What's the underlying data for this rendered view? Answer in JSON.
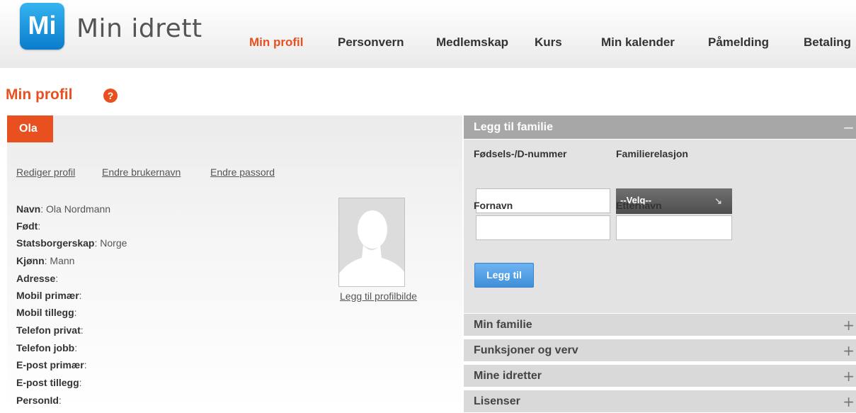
{
  "header": {
    "logo_mark": "Mi",
    "app_title": "Min idrett",
    "nav": [
      {
        "label": "Min profil",
        "active": true
      },
      {
        "label": "Personvern",
        "active": false
      },
      {
        "label": "Medlemskap",
        "active": false
      },
      {
        "label": "Kurs",
        "active": false
      },
      {
        "label": "Min kalender",
        "active": false
      },
      {
        "label": "Påmelding",
        "active": false
      },
      {
        "label": "Betaling",
        "active": false
      }
    ]
  },
  "page": {
    "title": "Min profil",
    "help_icon": "?"
  },
  "profile": {
    "name_tab": "Ola",
    "links": [
      "Rediger profil",
      "Endre brukernavn",
      "Endre passord"
    ],
    "fields": [
      {
        "label": "Navn",
        "value": ": Ola Nordmann"
      },
      {
        "label": "Født",
        "value": ":"
      },
      {
        "label": "Statsborgerskap",
        "value": ": Norge"
      },
      {
        "label": "Kjønn",
        "value": ": Mann"
      },
      {
        "label": "Adresse",
        "value": ":"
      },
      {
        "label": "Mobil primær",
        "value": ":"
      },
      {
        "label": "Mobil tillegg",
        "value": ":"
      },
      {
        "label": "Telefon privat",
        "value": ":"
      },
      {
        "label": "Telefon jobb",
        "value": ":"
      },
      {
        "label": "E-post primær",
        "value": ":"
      },
      {
        "label": "E-post tillegg",
        "value": ":"
      },
      {
        "label": "PersonId",
        "value": ":"
      }
    ],
    "add_photo_link": "Legg til profilbilde"
  },
  "family": {
    "add_section": {
      "title": "Legg til familie",
      "toggle_icon": "−",
      "birth_number_label": "Fødsels-/D-nummer",
      "birth_number_value": "",
      "relation_label": "Familierelasjon",
      "relation_selected": "--Velg--",
      "first_name_label": "Fornavn",
      "first_name_value": "",
      "last_name_label": "Etternavn",
      "last_name_value": "",
      "add_button": "Legg til"
    },
    "sections": [
      {
        "title": "Min familie",
        "toggle_icon": "+"
      },
      {
        "title": "Funksjoner og verv",
        "toggle_icon": "+"
      },
      {
        "title": "Mine idretter",
        "toggle_icon": "+"
      },
      {
        "title": "Lisenser",
        "toggle_icon": "+"
      }
    ]
  },
  "colors": {
    "accent": "#e8501f",
    "button_blue": "#4a97dd",
    "logo_blue": "#1b95df"
  }
}
